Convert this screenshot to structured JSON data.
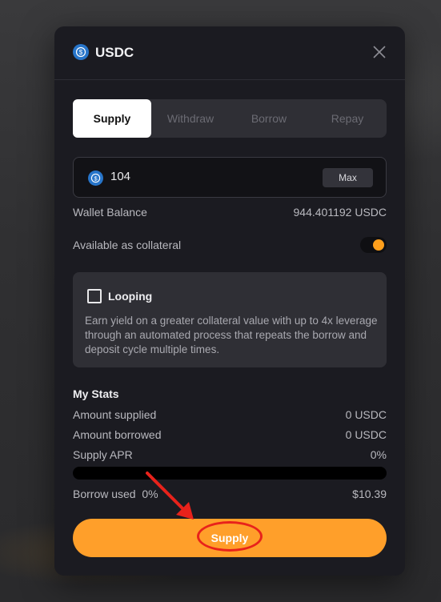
{
  "modal": {
    "title": "USDC",
    "tabs": [
      {
        "label": "Supply",
        "active": true
      },
      {
        "label": "Withdraw",
        "active": false
      },
      {
        "label": "Borrow",
        "active": false
      },
      {
        "label": "Repay",
        "active": false
      }
    ],
    "amount": {
      "value": "104",
      "max_label": "Max"
    },
    "wallet_balance": {
      "label": "Wallet Balance",
      "value": "944.401192 USDC"
    },
    "collateral": {
      "label": "Available as collateral",
      "enabled": true
    },
    "looping": {
      "title": "Looping",
      "description": "Earn yield on a greater collateral value with up to 4x leverage through an automated process that repeats the borrow and deposit cycle multiple times."
    },
    "stats": {
      "title": "My Stats",
      "rows": [
        {
          "label": "Amount supplied",
          "value": "0 USDC"
        },
        {
          "label": "Amount borrowed",
          "value": "0 USDC"
        },
        {
          "label": "Supply APR",
          "value": "0%"
        }
      ],
      "borrow_used": {
        "label": "Borrow used  0%",
        "value": "$10.39",
        "fraction": 0
      }
    },
    "submit_label": "Supply"
  },
  "colors": {
    "accent": "#ff9f2a",
    "usdc_blue": "#2775ca",
    "annotation_red": "#e8221b"
  },
  "icons": {
    "token": "usdc-icon",
    "close": "close-icon",
    "annotation": "red-arrow"
  }
}
